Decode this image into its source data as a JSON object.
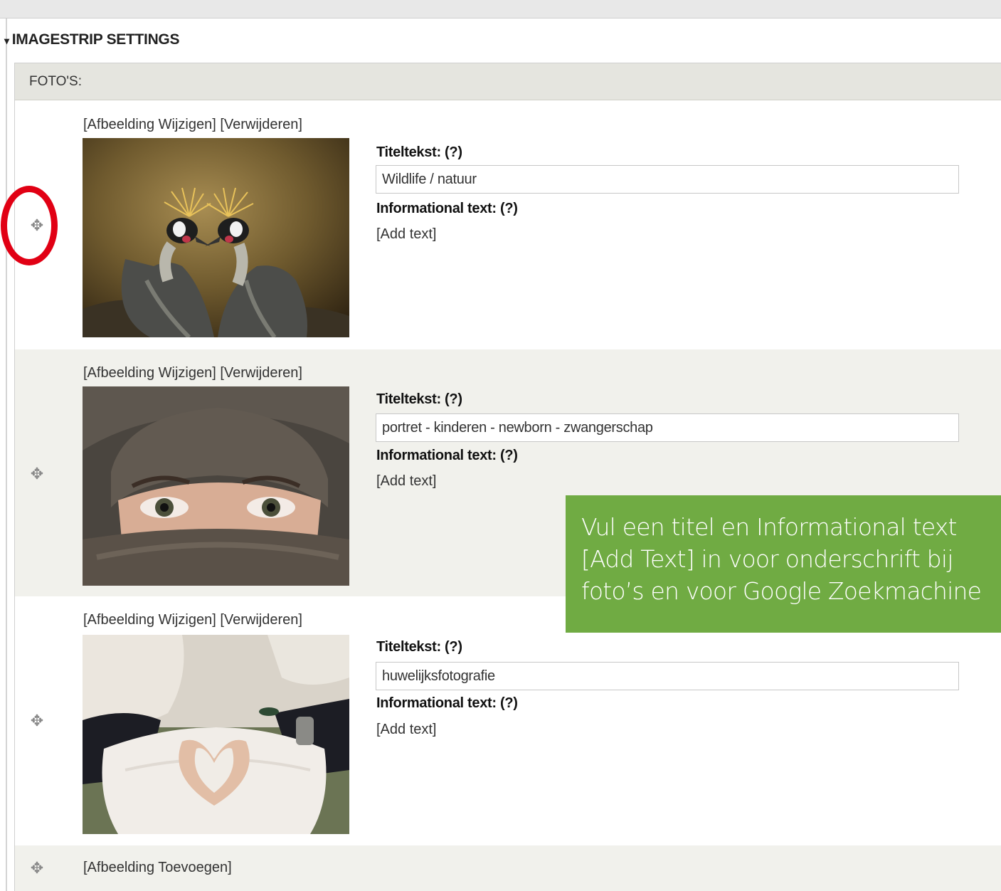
{
  "section": {
    "title": "IMAGESTRIP SETTINGS"
  },
  "panel": {
    "header": "FOTO'S:"
  },
  "photos": [
    {
      "actions": "[Afbeelding Wijzigen] [Verwijderen]",
      "title_label": "Titeltekst: (?)",
      "title_value": "Wildlife / natuur",
      "info_label": "Informational text: (?)",
      "add_text": "[Add text]"
    },
    {
      "actions": "[Afbeelding Wijzigen] [Verwijderen]",
      "title_label": "Titeltekst: (?)",
      "title_value": "portret - kinderen - newborn - zwangerschap",
      "info_label": "Informational text: (?)",
      "add_text": "[Add text]"
    },
    {
      "actions": "[Afbeelding Wijzigen] [Verwijderen]",
      "title_label": "Titeltekst: (?)",
      "title_value": "huwelijksfotografie",
      "info_label": "Informational text: (?)",
      "add_text": "[Add text]"
    }
  ],
  "add_image": "[Afbeelding Toevoegen]",
  "callout": {
    "lines": [
      "Vul een titel en Informational text",
      "[Add Text] in voor onderschrift bij",
      "foto’s en voor Google Zoekmachine"
    ]
  },
  "icons": {
    "drag": "move-handle-icon",
    "highlight": "red-circle-annotation"
  },
  "colors": {
    "callout": "#70ab43",
    "highlight": "#e10014",
    "panel_header": "#e5e5df",
    "row_alt": "#f1f1ec"
  }
}
